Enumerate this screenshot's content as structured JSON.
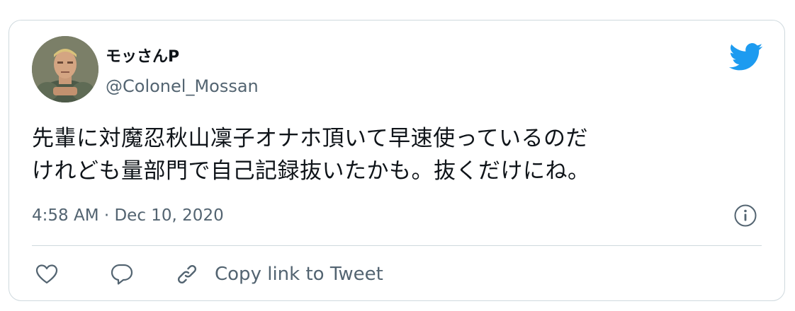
{
  "tweet": {
    "display_name": "モッさんP",
    "handle": "@Colonel_Mossan",
    "text_lines": [
      "先輩に対魔忍秋山凜子オナホ頂いて早速使っているのだ",
      "けれども量部門で自己記録抜いたかも。抜くだけにね。"
    ],
    "timestamp": "4:58 AM · Dec 10, 2020"
  },
  "actions": {
    "copy_link_label": "Copy link to Tweet"
  },
  "colors": {
    "twitter_blue": "#1d9bf0",
    "secondary_text": "#536471",
    "border": "#cfd9de"
  },
  "icons": {
    "avatar": "avatar-soldier-figure",
    "logo": "twitter-bird-icon",
    "info": "info-icon",
    "like": "heart-icon",
    "reply": "reply-bubble-icon",
    "copy": "link-icon"
  }
}
